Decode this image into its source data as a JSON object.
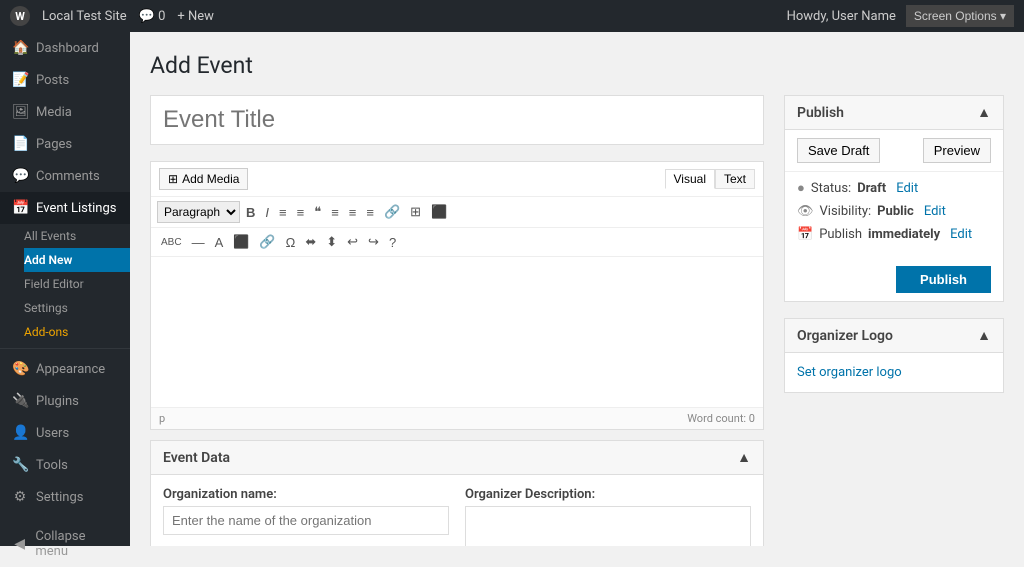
{
  "adminbar": {
    "wp_icon": "W",
    "site_name": "Local Test Site",
    "new_label": "+ New",
    "comments_label": "💬 0",
    "howdy": "Howdy, User Name",
    "screen_options": "Screen Options ▾"
  },
  "sidebar": {
    "logo_text": "Local Test Site",
    "items": [
      {
        "id": "dashboard",
        "icon": "🏠",
        "label": "Dashboard"
      },
      {
        "id": "posts",
        "icon": "📝",
        "label": "Posts"
      },
      {
        "id": "media",
        "icon": "🖼",
        "label": "Media"
      },
      {
        "id": "pages",
        "icon": "📄",
        "label": "Pages"
      },
      {
        "id": "comments",
        "icon": "💬",
        "label": "Comments"
      },
      {
        "id": "event-listings",
        "icon": "📅",
        "label": "Event Listings",
        "active": true
      }
    ],
    "event_sub": [
      {
        "id": "all-events",
        "label": "All Events"
      },
      {
        "id": "add-new",
        "label": "Add New",
        "current": true
      },
      {
        "id": "field-editor",
        "label": "Field Editor"
      },
      {
        "id": "settings",
        "label": "Settings"
      },
      {
        "id": "add-ons",
        "label": "Add-ons",
        "orange": true
      }
    ],
    "bottom_items": [
      {
        "id": "appearance",
        "icon": "🎨",
        "label": "Appearance"
      },
      {
        "id": "plugins",
        "icon": "🔌",
        "label": "Plugins"
      },
      {
        "id": "users",
        "icon": "👤",
        "label": "Users"
      },
      {
        "id": "tools",
        "icon": "🔧",
        "label": "Tools"
      },
      {
        "id": "settings-bottom",
        "icon": "⚙",
        "label": "Settings"
      }
    ],
    "collapse_label": "Collapse menu"
  },
  "page": {
    "title": "Add Event"
  },
  "editor": {
    "title_placeholder": "Event Title",
    "add_media_label": "Add Media",
    "visual_tab": "Visual",
    "text_tab": "Text",
    "toolbar": {
      "paragraph_label": "Paragraph",
      "buttons": [
        "B",
        "I",
        "≡",
        "≡",
        "❝",
        "≡",
        "≡",
        "≡",
        "🔗",
        "≡",
        "⊞"
      ]
    },
    "toolbar2": {
      "buttons": [
        "abc",
        "—",
        "A",
        "⬛",
        "🔗",
        "Ω",
        "⬌",
        "⬍",
        "↩",
        "↪",
        "?"
      ]
    },
    "content": "",
    "footer_tag": "p",
    "word_count_label": "Word count: 0"
  },
  "event_data": {
    "title": "Event Data",
    "collapse_icon": "▲",
    "org_name_label": "Organization name:",
    "org_name_placeholder": "Enter the name of the organization",
    "org_desc_label": "Organizer Description:"
  },
  "publish_box": {
    "title": "Publish",
    "collapse_icon": "▲",
    "save_draft_label": "Save Draft",
    "preview_label": "Preview",
    "status_label": "Status:",
    "status_value": "Draft",
    "status_edit": "Edit",
    "visibility_label": "Visibility:",
    "visibility_value": "Public",
    "visibility_edit": "Edit",
    "publish_time_label": "Publish",
    "publish_time_value": "immediately",
    "publish_time_edit": "Edit",
    "publish_btn_label": "Publish"
  },
  "organizer_box": {
    "title": "Organizer Logo",
    "collapse_icon": "▲",
    "set_logo_label": "Set organizer logo"
  }
}
